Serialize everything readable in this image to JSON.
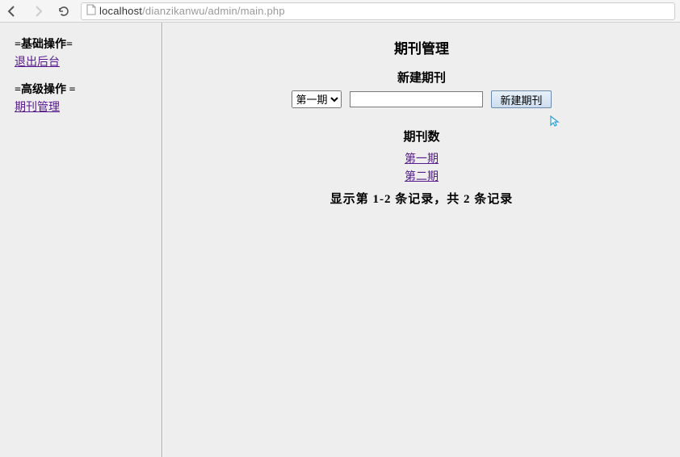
{
  "url": {
    "host": "localhost",
    "path": "/dianzikanwu/admin/main.php"
  },
  "sidebar": {
    "section1": {
      "title": "=基础操作=",
      "link_label": "退出后台"
    },
    "section2": {
      "title": "=高级操作 =",
      "link_label": "期刊管理"
    }
  },
  "main": {
    "title": "期刊管理",
    "new_section_title": "新建期刊",
    "select_options": [
      "第一期"
    ],
    "select_value": "第一期",
    "input_value": "",
    "submit_label": "新建期刊",
    "count_title": "期刊数",
    "issues": [
      "第一期",
      "第二期"
    ],
    "record_text": "显示第 1-2 条记录，共 2 条记录"
  }
}
